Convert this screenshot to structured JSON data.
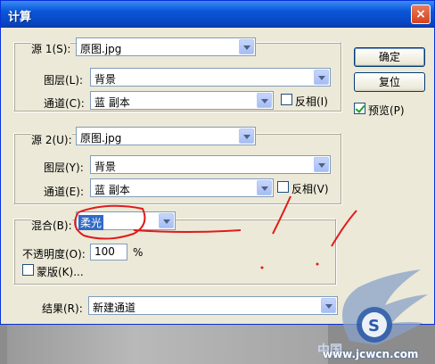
{
  "dialog": {
    "title": "计算",
    "close_label": "×"
  },
  "source1": {
    "source_label": "源 1(S):",
    "source_value": "原图.jpg",
    "layer_label": "图层(L):",
    "layer_value": "背景",
    "channel_label": "通道(C):",
    "channel_value": "蓝 副本",
    "invert_label": "反相(I)"
  },
  "source2": {
    "source_label": "源 2(U):",
    "source_value": "原图.jpg",
    "layer_label": "图层(Y):",
    "layer_value": "背景",
    "channel_label": "通道(E):",
    "channel_value": "蓝 副本",
    "invert_label": "反相(V)"
  },
  "blend": {
    "blend_label": "混合(B):",
    "blend_value": "柔光",
    "opacity_label": "不透明度(O):",
    "opacity_value": "100",
    "opacity_unit": "%",
    "mask_label": "蒙版(K)..."
  },
  "result": {
    "result_label": "结果(R):",
    "result_value": "新建通道"
  },
  "buttons": {
    "ok": "确定",
    "reset": "复位",
    "preview_label": "预览(P)"
  },
  "watermark": {
    "text1": "中国",
    "text2": "www.jcwcn.com"
  },
  "colors": {
    "titlebar": "#0a56d8",
    "dialog_bg": "#ece9d8",
    "annotation": "#e01b1b",
    "highlight": "#316ac5"
  }
}
